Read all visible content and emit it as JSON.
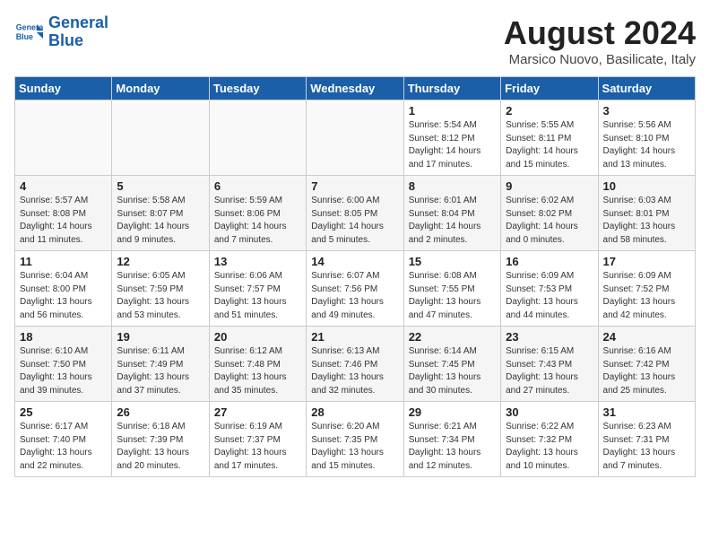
{
  "header": {
    "logo_line1": "General",
    "logo_line2": "Blue",
    "month": "August 2024",
    "location": "Marsico Nuovo, Basilicate, Italy"
  },
  "weekdays": [
    "Sunday",
    "Monday",
    "Tuesday",
    "Wednesday",
    "Thursday",
    "Friday",
    "Saturday"
  ],
  "weeks": [
    [
      {
        "day": "",
        "info": ""
      },
      {
        "day": "",
        "info": ""
      },
      {
        "day": "",
        "info": ""
      },
      {
        "day": "",
        "info": ""
      },
      {
        "day": "1",
        "info": "Sunrise: 5:54 AM\nSunset: 8:12 PM\nDaylight: 14 hours\nand 17 minutes."
      },
      {
        "day": "2",
        "info": "Sunrise: 5:55 AM\nSunset: 8:11 PM\nDaylight: 14 hours\nand 15 minutes."
      },
      {
        "day": "3",
        "info": "Sunrise: 5:56 AM\nSunset: 8:10 PM\nDaylight: 14 hours\nand 13 minutes."
      }
    ],
    [
      {
        "day": "4",
        "info": "Sunrise: 5:57 AM\nSunset: 8:08 PM\nDaylight: 14 hours\nand 11 minutes."
      },
      {
        "day": "5",
        "info": "Sunrise: 5:58 AM\nSunset: 8:07 PM\nDaylight: 14 hours\nand 9 minutes."
      },
      {
        "day": "6",
        "info": "Sunrise: 5:59 AM\nSunset: 8:06 PM\nDaylight: 14 hours\nand 7 minutes."
      },
      {
        "day": "7",
        "info": "Sunrise: 6:00 AM\nSunset: 8:05 PM\nDaylight: 14 hours\nand 5 minutes."
      },
      {
        "day": "8",
        "info": "Sunrise: 6:01 AM\nSunset: 8:04 PM\nDaylight: 14 hours\nand 2 minutes."
      },
      {
        "day": "9",
        "info": "Sunrise: 6:02 AM\nSunset: 8:02 PM\nDaylight: 14 hours\nand 0 minutes."
      },
      {
        "day": "10",
        "info": "Sunrise: 6:03 AM\nSunset: 8:01 PM\nDaylight: 13 hours\nand 58 minutes."
      }
    ],
    [
      {
        "day": "11",
        "info": "Sunrise: 6:04 AM\nSunset: 8:00 PM\nDaylight: 13 hours\nand 56 minutes."
      },
      {
        "day": "12",
        "info": "Sunrise: 6:05 AM\nSunset: 7:59 PM\nDaylight: 13 hours\nand 53 minutes."
      },
      {
        "day": "13",
        "info": "Sunrise: 6:06 AM\nSunset: 7:57 PM\nDaylight: 13 hours\nand 51 minutes."
      },
      {
        "day": "14",
        "info": "Sunrise: 6:07 AM\nSunset: 7:56 PM\nDaylight: 13 hours\nand 49 minutes."
      },
      {
        "day": "15",
        "info": "Sunrise: 6:08 AM\nSunset: 7:55 PM\nDaylight: 13 hours\nand 47 minutes."
      },
      {
        "day": "16",
        "info": "Sunrise: 6:09 AM\nSunset: 7:53 PM\nDaylight: 13 hours\nand 44 minutes."
      },
      {
        "day": "17",
        "info": "Sunrise: 6:09 AM\nSunset: 7:52 PM\nDaylight: 13 hours\nand 42 minutes."
      }
    ],
    [
      {
        "day": "18",
        "info": "Sunrise: 6:10 AM\nSunset: 7:50 PM\nDaylight: 13 hours\nand 39 minutes."
      },
      {
        "day": "19",
        "info": "Sunrise: 6:11 AM\nSunset: 7:49 PM\nDaylight: 13 hours\nand 37 minutes."
      },
      {
        "day": "20",
        "info": "Sunrise: 6:12 AM\nSunset: 7:48 PM\nDaylight: 13 hours\nand 35 minutes."
      },
      {
        "day": "21",
        "info": "Sunrise: 6:13 AM\nSunset: 7:46 PM\nDaylight: 13 hours\nand 32 minutes."
      },
      {
        "day": "22",
        "info": "Sunrise: 6:14 AM\nSunset: 7:45 PM\nDaylight: 13 hours\nand 30 minutes."
      },
      {
        "day": "23",
        "info": "Sunrise: 6:15 AM\nSunset: 7:43 PM\nDaylight: 13 hours\nand 27 minutes."
      },
      {
        "day": "24",
        "info": "Sunrise: 6:16 AM\nSunset: 7:42 PM\nDaylight: 13 hours\nand 25 minutes."
      }
    ],
    [
      {
        "day": "25",
        "info": "Sunrise: 6:17 AM\nSunset: 7:40 PM\nDaylight: 13 hours\nand 22 minutes."
      },
      {
        "day": "26",
        "info": "Sunrise: 6:18 AM\nSunset: 7:39 PM\nDaylight: 13 hours\nand 20 minutes."
      },
      {
        "day": "27",
        "info": "Sunrise: 6:19 AM\nSunset: 7:37 PM\nDaylight: 13 hours\nand 17 minutes."
      },
      {
        "day": "28",
        "info": "Sunrise: 6:20 AM\nSunset: 7:35 PM\nDaylight: 13 hours\nand 15 minutes."
      },
      {
        "day": "29",
        "info": "Sunrise: 6:21 AM\nSunset: 7:34 PM\nDaylight: 13 hours\nand 12 minutes."
      },
      {
        "day": "30",
        "info": "Sunrise: 6:22 AM\nSunset: 7:32 PM\nDaylight: 13 hours\nand 10 minutes."
      },
      {
        "day": "31",
        "info": "Sunrise: 6:23 AM\nSunset: 7:31 PM\nDaylight: 13 hours\nand 7 minutes."
      }
    ]
  ]
}
